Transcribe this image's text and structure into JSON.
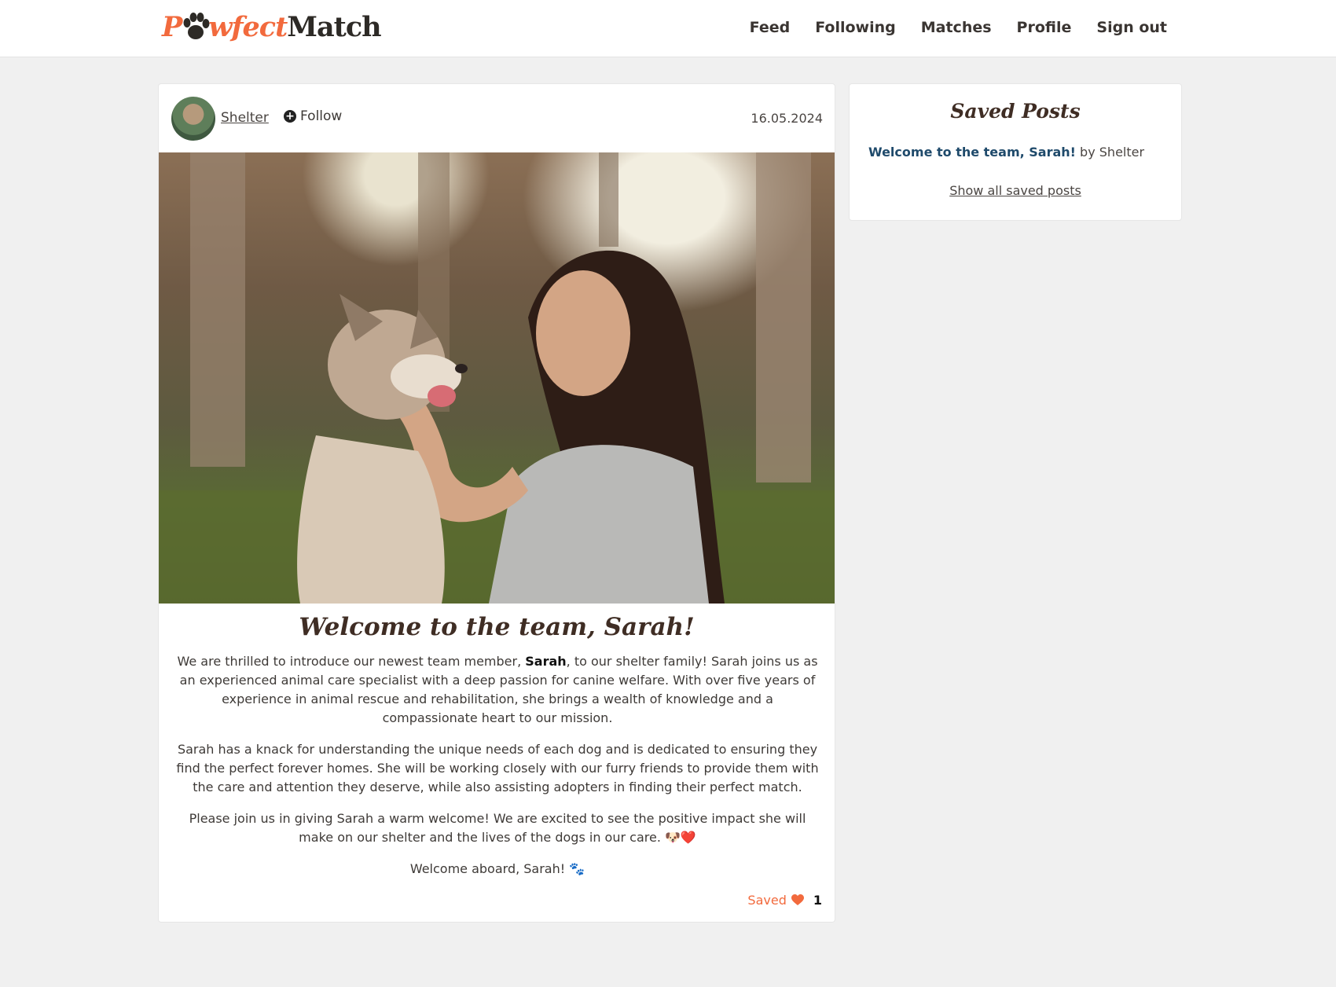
{
  "brand": {
    "logo_p": "P",
    "logo_w": "wfect",
    "logo_match": "Match",
    "accent_color": "#f26a3d"
  },
  "nav": {
    "items": [
      {
        "label": "Feed"
      },
      {
        "label": "Following"
      },
      {
        "label": "Matches"
      },
      {
        "label": "Profile"
      },
      {
        "label": "Sign out"
      }
    ]
  },
  "post": {
    "author": "Shelter",
    "follow_label": "Follow",
    "follow_icon": "plus-circle-icon",
    "date": "16.05.2024",
    "image_alt": "dog-and-woman-photo",
    "title": "Welcome to the team, Sarah!",
    "para1_prefix": "We are thrilled to introduce our newest team member, ",
    "para1_bold": "Sarah",
    "para1_suffix": ", to our shelter family! Sarah joins us as an experienced animal care specialist with a deep passion for canine welfare. With over five years of experience in animal rescue and rehabilitation, she brings a wealth of knowledge and a compassionate heart to our mission.",
    "para2": "Sarah has a knack for understanding the unique needs of each dog and is dedicated to ensuring they find the perfect forever homes. She will be working closely with our furry friends to provide them with the care and attention they deserve, while also assisting adopters in finding their perfect match.",
    "para3": "Please join us in giving Sarah a warm welcome! We are excited to see the positive impact she will make on our shelter and the lives of the dogs in our care. 🐶❤️",
    "para4": "Welcome aboard, Sarah! 🐾",
    "saved_label": "Saved",
    "saved_icon": "heart-icon",
    "like_count": "1"
  },
  "sidebar": {
    "title": "Saved Posts",
    "items": [
      {
        "title": "Welcome to the team, Sarah!",
        "by": " by Shelter"
      }
    ],
    "show_all_label": "Show all saved posts"
  }
}
